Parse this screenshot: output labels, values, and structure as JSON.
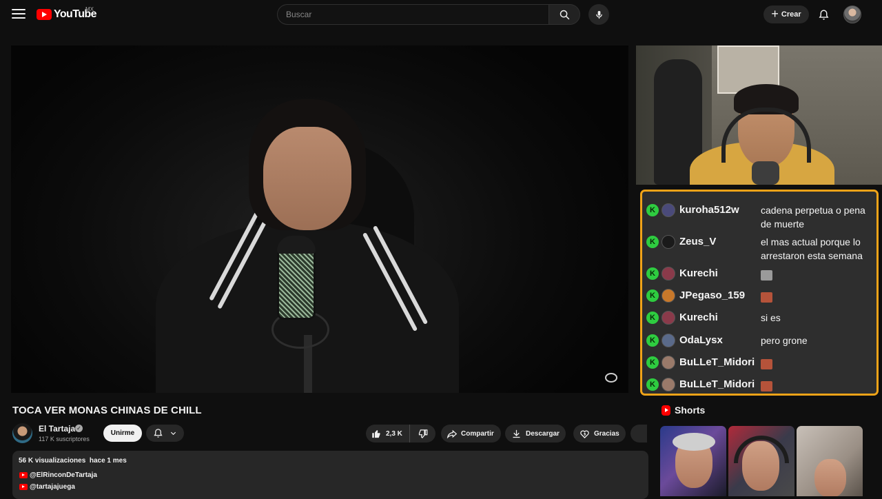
{
  "header": {
    "logo_text": "YouTube",
    "region": "MX",
    "search_placeholder": "Buscar",
    "create_label": "Crear"
  },
  "video": {
    "title": "TOCA VER MONAS CHINAS DE CHILL",
    "channel_name": "El Tartaja",
    "subscribers": "117 K suscriptores",
    "join_label": "Unirme",
    "likes": "2,3 K",
    "share_label": "Compartir",
    "download_label": "Descargar",
    "thanks_label": "Gracias"
  },
  "description": {
    "views": "56 K visualizaciones",
    "date": "hace 1 mes",
    "links": [
      "@ElRinconDeTartaja",
      "@tartajajuega"
    ]
  },
  "chat": {
    "messages": [
      {
        "user": "kuroha512w",
        "text": "cadena perpetua o pena de muerte",
        "avatar_color": "#4a4a7a"
      },
      {
        "user": "Zeus_V",
        "text": "el mas actual porque lo arrestaron esta semana",
        "avatar_color": "#1a1a1a"
      },
      {
        "user": "Kurechi",
        "text": "",
        "emote": "cat-emote",
        "avatar_color": "#8a3a4a"
      },
      {
        "user": "JPegaso_159",
        "text": "",
        "emote": "face-emote",
        "avatar_color": "#c8782a"
      },
      {
        "user": "Kurechi",
        "text": "si es",
        "avatar_color": "#8a3a4a"
      },
      {
        "user": "OdaLysx",
        "text": "pero grone",
        "avatar_color": "#5a6a8a"
      },
      {
        "user": "BuLLeT_Midori",
        "text": "",
        "emote": "face-emote",
        "avatar_color": "#9a7a6a"
      },
      {
        "user": "BuLLeT_Midori",
        "text": "",
        "emote": "face-emote",
        "avatar_color": "#9a7a6a"
      }
    ],
    "badge_letter": "K",
    "badge_color": "#2ecc40",
    "border_color": "#f0a318"
  },
  "shorts": {
    "title": "Shorts"
  },
  "colors": {
    "brand_red": "#ff0000",
    "background": "#0f0f0f",
    "surface": "#272727"
  }
}
